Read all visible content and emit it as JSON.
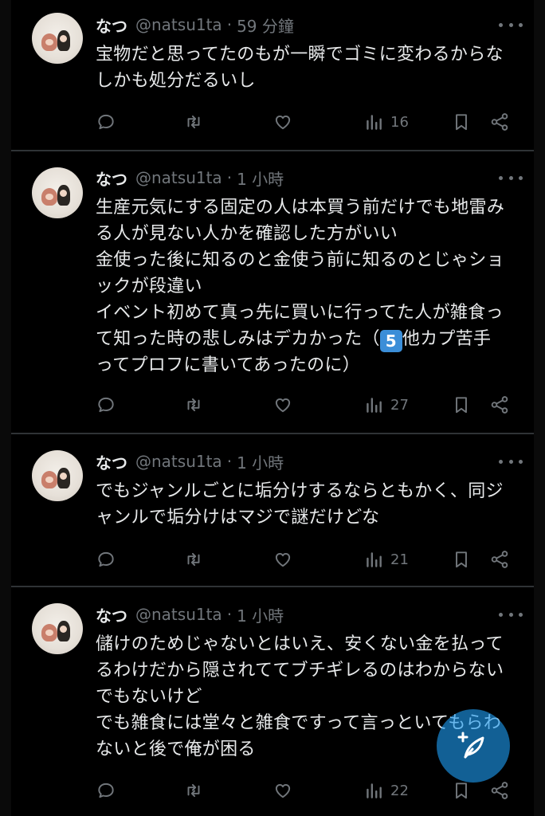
{
  "tweets": [
    {
      "name": "なつ",
      "handle": "@natsu1ta",
      "separator": "·",
      "time": "59 分鐘",
      "text": "宝物だと思ってたのもが一瞬でゴミに変わるからな\nしかも処分だるいし",
      "views": "16"
    },
    {
      "name": "なつ",
      "handle": "@natsu1ta",
      "separator": "·",
      "time": "1 小時",
      "text_before": "生産元気にする固定の人は本買う前だけでも地雷み\nる人が見ない人かを確認した方がいい\n金使った後に知るのと金使う前に知るのとじゃショ\nックが段違い\nイベント初めて真っ先に買いに行ってた人が雑食っ\nて知った時の悲しみはデカかった（",
      "emoji": "5",
      "text_after": "他カプ苦手\nってプロフに書いてあったのに）",
      "views": "27"
    },
    {
      "name": "なつ",
      "handle": "@natsu1ta",
      "separator": "·",
      "time": "1 小時",
      "text": "でもジャンルごとに垢分けするならともかく、同ジ\nャンルで垢分けはマジで謎だけどな",
      "views": "21"
    },
    {
      "name": "なつ",
      "handle": "@natsu1ta",
      "separator": "·",
      "time": "1 小時",
      "text": "儲けのためじゃないとはいえ、安くない金を払って\nるわけだから隠されててブチギレるのはわからない\nでもないけど\nでも雑食には堂々と雑食ですって言っといてもらわ\nないと後で俺が困る",
      "views": "22"
    }
  ],
  "icons": {
    "reply": "reply-icon",
    "retweet": "retweet-icon",
    "like": "heart-icon",
    "views": "views-chart-icon",
    "bookmark": "bookmark-icon",
    "share": "share-icon",
    "more": "more-dots-icon",
    "compose": "compose-post-icon"
  },
  "colors": {
    "background": "#000000",
    "text": "#e7e9ea",
    "secondary": "#71767b",
    "divider": "#2f3336",
    "accent": "#1d9bf0"
  }
}
